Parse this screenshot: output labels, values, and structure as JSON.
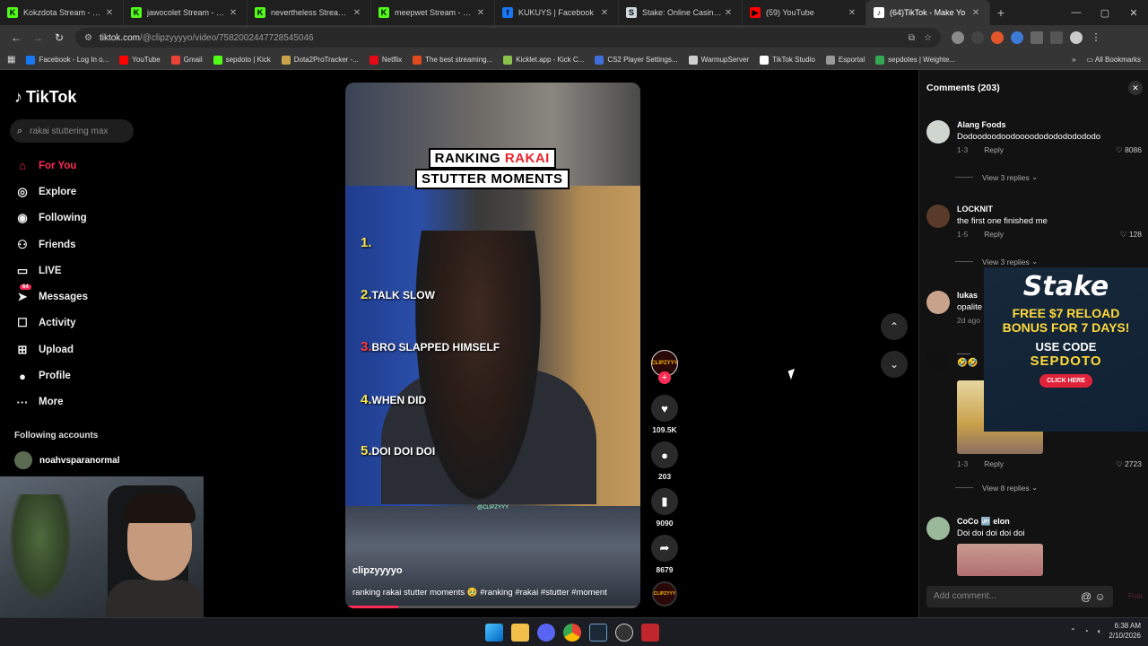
{
  "browser": {
    "tabs": [
      {
        "label": "Kokzdota Stream - Watch",
        "color": "#53fc18",
        "glyph": "K"
      },
      {
        "label": "jawocolet Stream - Watch",
        "color": "#53fc18",
        "glyph": "K"
      },
      {
        "label": "nevertheless Stream - Wa",
        "color": "#53fc18",
        "glyph": "K"
      },
      {
        "label": "meepwet Stream - Watch",
        "color": "#53fc18",
        "glyph": "K"
      },
      {
        "label": "KUKUYS | Facebook",
        "color": "#1877f2",
        "glyph": "f"
      },
      {
        "label": "Stake: Online Casino & Sp",
        "color": "#cfd8dc",
        "glyph": "S"
      },
      {
        "label": "(59) YouTube",
        "color": "#ff0000",
        "glyph": "▶"
      },
      {
        "label": "(64)TikTok - Make Yo",
        "color": "#ffffff",
        "glyph": "♪"
      }
    ],
    "url_host": "tiktok.com",
    "url_path": "/@clipzyyyyo/video/7582002447728545046",
    "bookmarks": [
      {
        "label": "Facebook - Log In o...",
        "color": "#1877f2"
      },
      {
        "label": "YouTube",
        "color": "#ff0000"
      },
      {
        "label": "Gmail",
        "color": "#ea4335"
      },
      {
        "label": "sepdoto | Kick",
        "color": "#53fc18"
      },
      {
        "label": "Dota2ProTracker -...",
        "color": "#c8a24a"
      },
      {
        "label": "Netflix",
        "color": "#e50914"
      },
      {
        "label": "The best streaming...",
        "color": "#e04a1f"
      },
      {
        "label": "Kicklet.app - Kick C...",
        "color": "#8bc34a"
      },
      {
        "label": "CS2 Player Settings...",
        "color": "#3f6fd8"
      },
      {
        "label": "WarmupServer",
        "color": "#d0d0d0"
      },
      {
        "label": "TikTok Studio",
        "color": "#ffffff"
      },
      {
        "label": "Esportal",
        "color": "#999999"
      },
      {
        "label": "sepdotes | Weighte...",
        "color": "#34a853"
      }
    ],
    "all_bookmarks": "All Bookmarks"
  },
  "sidebar": {
    "logo": "TikTok",
    "search_placeholder": "rakai stuttering max",
    "menu": [
      {
        "label": "For You",
        "icon": "⌂",
        "name": "home-icon"
      },
      {
        "label": "Explore",
        "icon": "◎",
        "name": "compass-icon"
      },
      {
        "label": "Following",
        "icon": "◉",
        "name": "following-icon"
      },
      {
        "label": "Friends",
        "icon": "⚇",
        "name": "friends-icon"
      },
      {
        "label": "LIVE",
        "icon": "▭",
        "name": "live-icon"
      },
      {
        "label": "Messages",
        "icon": "➤",
        "name": "messages-icon"
      },
      {
        "label": "Activity",
        "icon": "☐",
        "name": "activity-icon"
      },
      {
        "label": "Upload",
        "icon": "⊞",
        "name": "upload-icon"
      },
      {
        "label": "Profile",
        "icon": "●",
        "name": "profile-icon"
      },
      {
        "label": "More",
        "icon": "···",
        "name": "more-icon"
      }
    ],
    "messages_badge": "64",
    "following_accounts_title": "Following accounts",
    "following_account": "noahvsparanormal"
  },
  "video": {
    "title_line1_a": "RANKING ",
    "title_line1_b": "RAKAI",
    "title_line2": "STUTTER MOMENTS",
    "list": [
      {
        "n": "1.",
        "text": ""
      },
      {
        "n": "2.",
        "text": "TALK SLOW"
      },
      {
        "n": "3.",
        "text": "BRO SLAPPED HIMSELF"
      },
      {
        "n": "4.",
        "text": "WHEN DID"
      },
      {
        "n": "5.",
        "text": "DOI DOI DOI"
      }
    ],
    "watermark": "@CLIPZYYY",
    "author": "clipzyyyyo",
    "caption": "ranking rakai stutter moments 🥹 #ranking  #rakai #stutter #moment",
    "progress_fraction": 0.18
  },
  "actions": {
    "avatar_text": "CLIPZYYY",
    "likes": "109.5K",
    "comments": "203",
    "saves": "9090",
    "shares": "8679"
  },
  "comments_panel": {
    "title": "Comments (203)",
    "items": [
      {
        "name": "Alang Foods",
        "text": "Dodoodoodoodoooodododododododo",
        "date": "1-3",
        "likes": "8086",
        "avatar": "#cfd6cf"
      },
      {
        "name": "LOCKNIT",
        "text": "the first one finished me",
        "date": "1-5",
        "likes": "128",
        "avatar": "#5a3a28"
      },
      {
        "name": "lukas",
        "text": "opalite",
        "date": "2d ago",
        "likes": "",
        "avatar": "#c9a28c"
      },
      {
        "name": "___",
        "text": "🤣🤣",
        "date": "1-3",
        "likes": "2723",
        "avatar": "#111111"
      },
      {
        "name": "CoCo 🆙 elon",
        "text": "Doi doi doi doi doi",
        "date": "",
        "likes": "",
        "avatar": "#9ab89a"
      }
    ],
    "view_replies": [
      "View 3 replies",
      "View 3 replies",
      "View 8 replies"
    ],
    "reply_label": "Reply",
    "add_placeholder": "Add comment...",
    "post_label": "Post"
  },
  "ad": {
    "brand": "Stake",
    "promo_line1": "FREE $7 RELOAD",
    "promo_line2": "BONUS FOR 7 DAYS!",
    "use_code": "USE CODE",
    "code": "SEPDOTO",
    "cta": "CLICK HERE"
  },
  "taskbar": {
    "time": "6:38 AM",
    "date": "2/10/2026"
  }
}
